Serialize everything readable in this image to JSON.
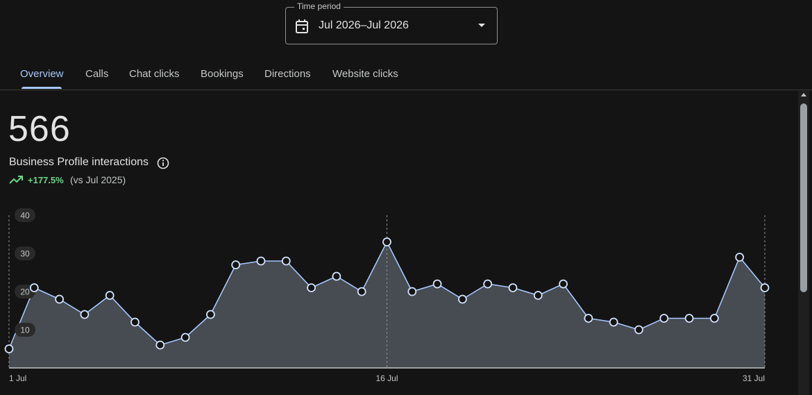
{
  "period": {
    "label": "Time period",
    "value": "Jul 2026–Jul 2026",
    "icons": {
      "calendar": "calendar-icon",
      "dropdown": "arrow-drop-down-icon"
    }
  },
  "tabs": [
    {
      "label": "Overview",
      "active": true
    },
    {
      "label": "Calls",
      "active": false
    },
    {
      "label": "Chat clicks",
      "active": false
    },
    {
      "label": "Bookings",
      "active": false
    },
    {
      "label": "Directions",
      "active": false
    },
    {
      "label": "Website clicks",
      "active": false
    }
  ],
  "metric": {
    "value": "566",
    "label": "Business Profile interactions",
    "change": "+177.5%",
    "comparison": "(vs Jul 2025)",
    "icons": {
      "info": "info-icon",
      "trend": "trending-up-icon"
    }
  },
  "colors": {
    "accent": "#a8c7fa",
    "positive": "#6dd58c",
    "area_fill": "#474b52",
    "background": "#141414"
  },
  "chart_data": {
    "type": "area",
    "x": [
      "1 Jul",
      "2 Jul",
      "3 Jul",
      "4 Jul",
      "5 Jul",
      "6 Jul",
      "7 Jul",
      "8 Jul",
      "9 Jul",
      "10 Jul",
      "11 Jul",
      "12 Jul",
      "13 Jul",
      "14 Jul",
      "15 Jul",
      "16 Jul",
      "17 Jul",
      "18 Jul",
      "19 Jul",
      "20 Jul",
      "21 Jul",
      "22 Jul",
      "23 Jul",
      "24 Jul",
      "25 Jul",
      "26 Jul",
      "27 Jul",
      "28 Jul",
      "29 Jul",
      "30 Jul",
      "31 Jul"
    ],
    "values": [
      5,
      21,
      18,
      14,
      19,
      12,
      6,
      8,
      14,
      27,
      28,
      28,
      21,
      24,
      20,
      33,
      20,
      22,
      18,
      22,
      21,
      19,
      22,
      13,
      12,
      10,
      13,
      13,
      13,
      29,
      21
    ],
    "x_tick_labels": [
      "1 Jul",
      "16 Jul",
      "31 Jul"
    ],
    "y_tick_labels": [
      "10",
      "20",
      "30",
      "40"
    ],
    "ylim": [
      0,
      40
    ],
    "grid": false,
    "markers": true
  }
}
